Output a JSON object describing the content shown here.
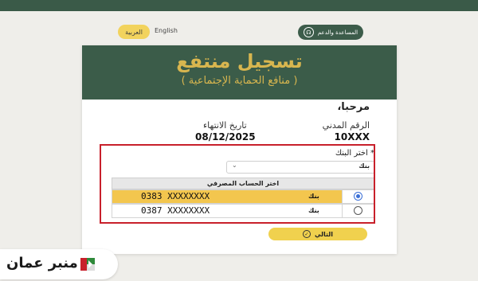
{
  "lang": {
    "arabic": "العربية",
    "english": "English"
  },
  "help_button": {
    "label": "المساعدة والدعم",
    "icon": "headset-icon"
  },
  "card": {
    "title": "تسجيل منتفع",
    "subtitle": "( منافع الحماية الإجتماعية )",
    "welcome": "مرحبا،",
    "civil_label": "الرقم المدني",
    "civil_value": "10XXX",
    "expiry_label": "تاريخ الانتهاء",
    "expiry_value": "08/12/2025",
    "bank_label": "* اختر البنك",
    "bank_select_value": "بنك",
    "accounts_header": "اختر الحساب المصرفي",
    "accounts": [
      {
        "number": "0383 XXXXXXXX",
        "bank": "بنك",
        "selected": true
      },
      {
        "number": "0387 XXXXXXXX",
        "bank": "بنك",
        "selected": false
      }
    ],
    "next_button": "التالي"
  },
  "watermark": {
    "text": "منبر عمان"
  },
  "colors": {
    "green": "#3b5c49",
    "gold": "#d8b64f",
    "yellow": "#f3c64e",
    "highlight_red": "#c8202b",
    "radio_blue": "#3b6fd6"
  }
}
